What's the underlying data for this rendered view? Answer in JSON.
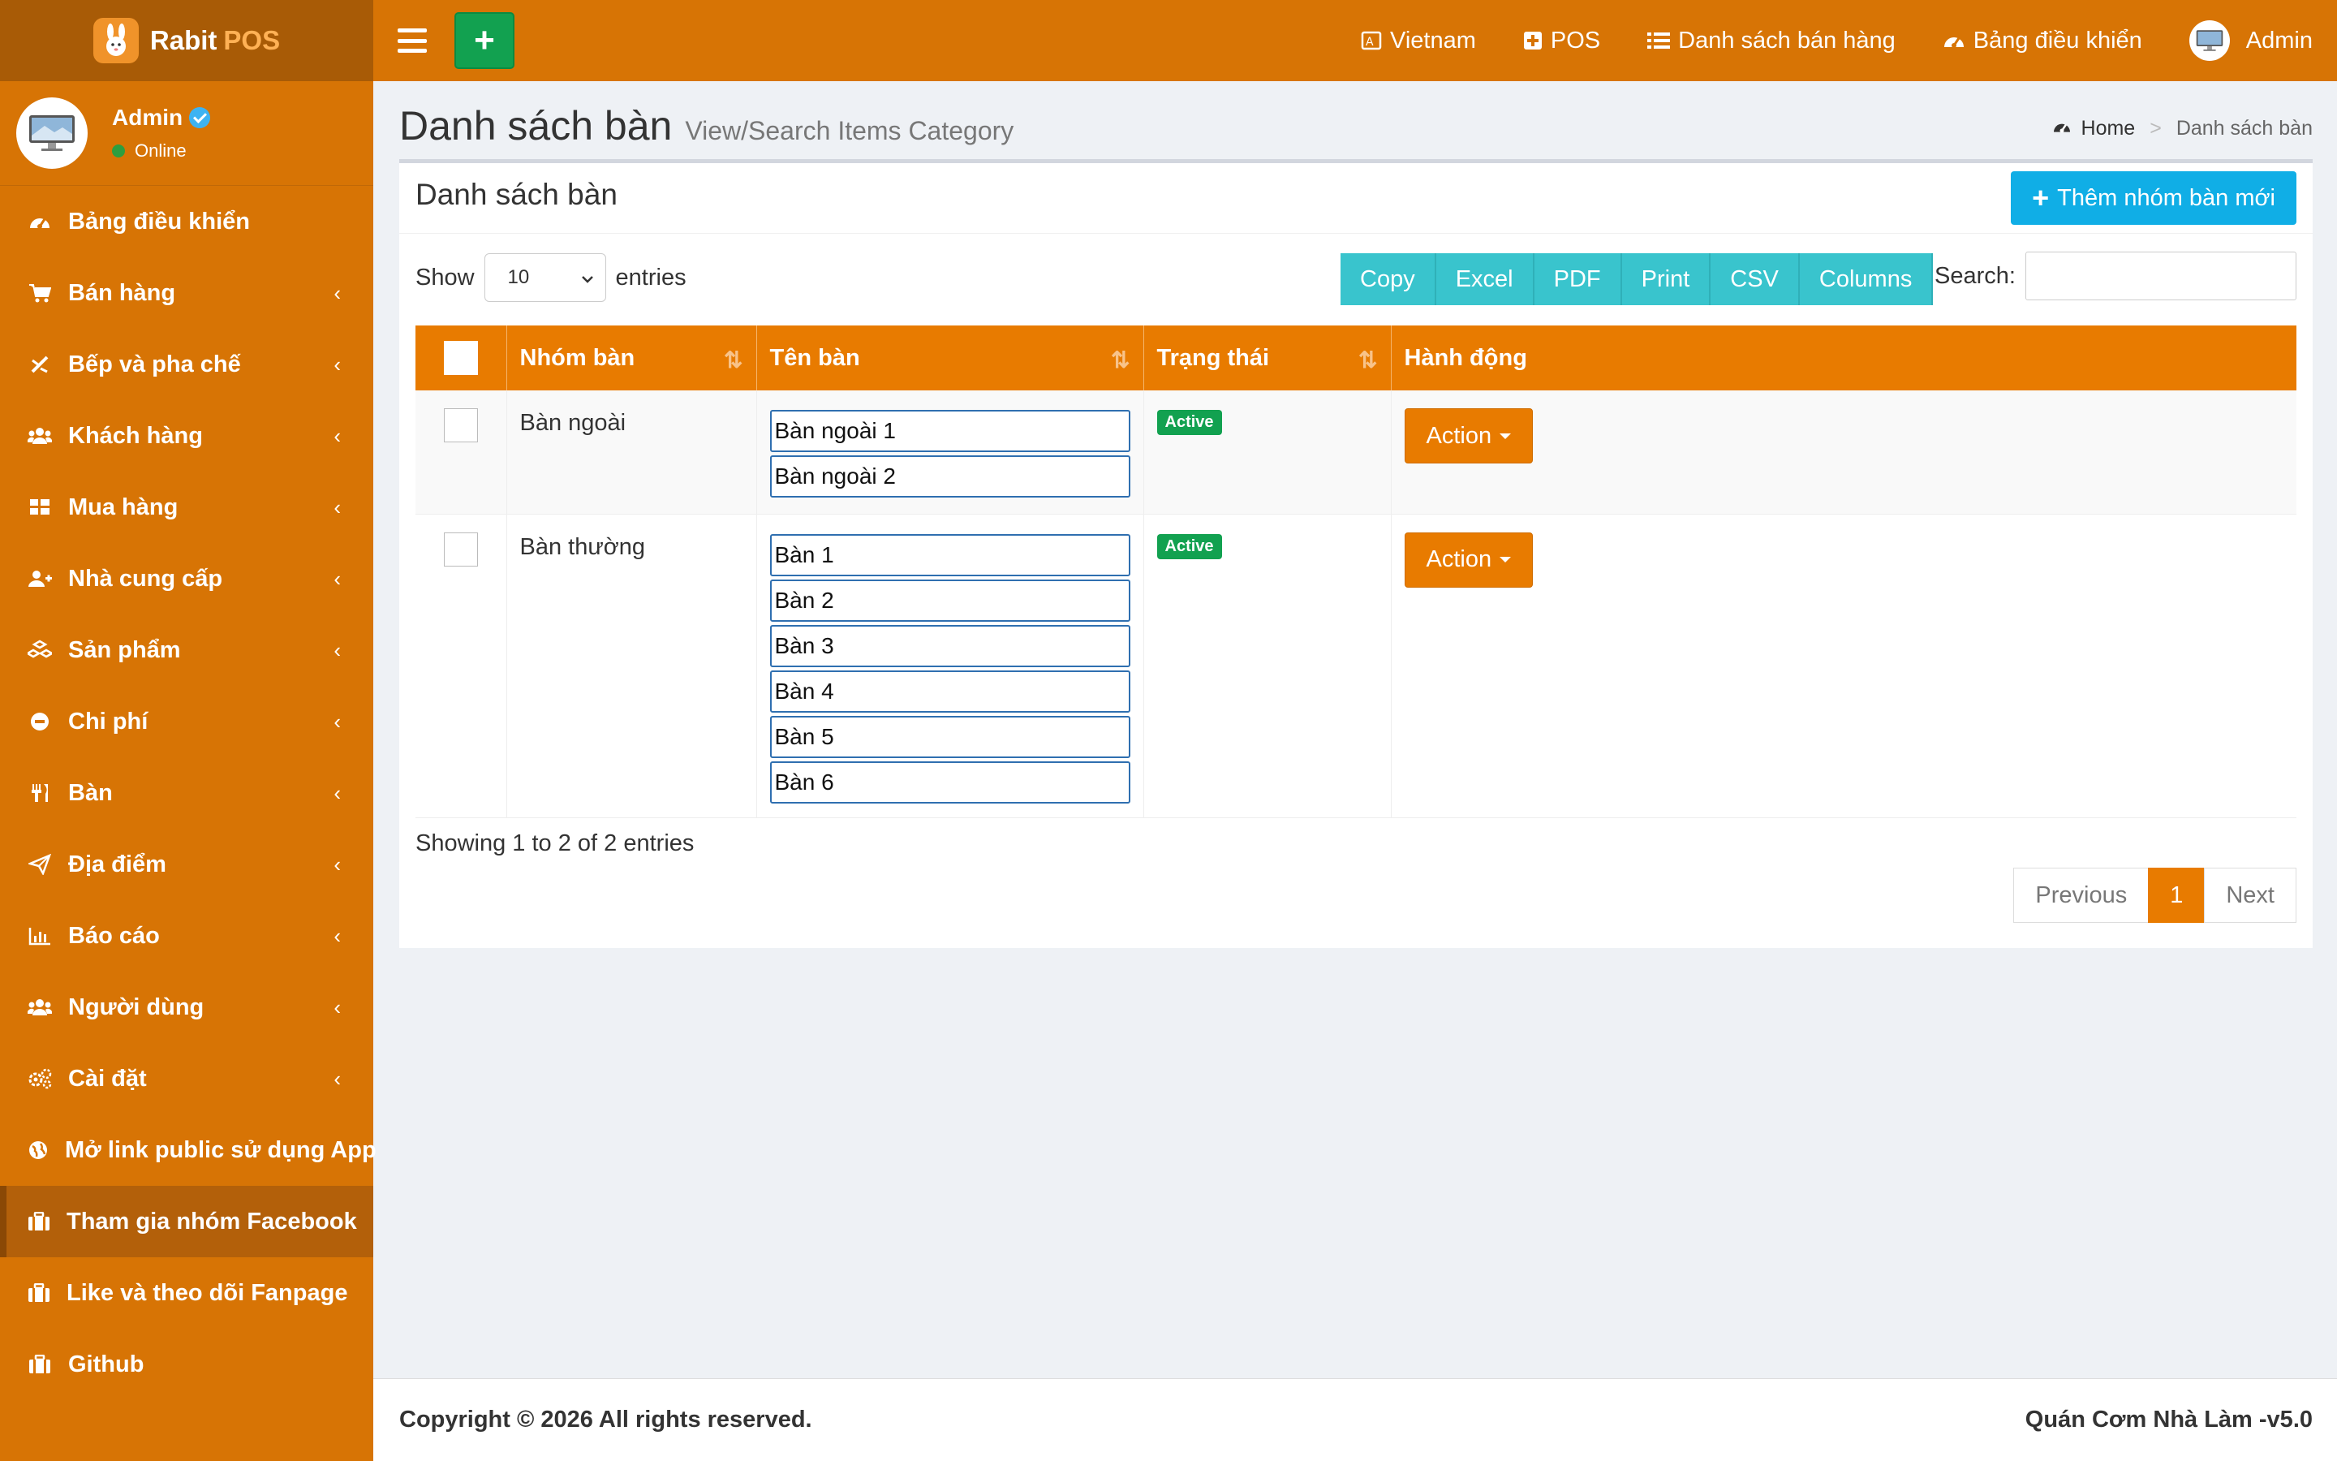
{
  "brand": {
    "name": "Rabit",
    "suffix": "POS"
  },
  "user": {
    "name": "Admin",
    "status": "Online"
  },
  "sidebar": {
    "items": [
      {
        "label": "Bảng điều khiển",
        "icon": "dashboard-icon",
        "has_children": false
      },
      {
        "label": "Bán hàng",
        "icon": "cart-icon",
        "has_children": true
      },
      {
        "label": "Bếp và pha chế",
        "icon": "kitchen-icon",
        "has_children": true
      },
      {
        "label": "Khách hàng",
        "icon": "users-icon",
        "has_children": true
      },
      {
        "label": "Mua hàng",
        "icon": "grid-icon",
        "has_children": true
      },
      {
        "label": "Nhà cung cấp",
        "icon": "user-plus-icon",
        "has_children": true
      },
      {
        "label": "Sản phẩm",
        "icon": "cubes-icon",
        "has_children": true
      },
      {
        "label": "Chi phí",
        "icon": "minus-circle-icon",
        "has_children": true
      },
      {
        "label": "Bàn",
        "icon": "cutlery-icon",
        "has_children": true
      },
      {
        "label": "Địa điểm",
        "icon": "paper-plane-icon",
        "has_children": true
      },
      {
        "label": "Báo cáo",
        "icon": "bar-chart-icon",
        "has_children": true
      },
      {
        "label": "Người dùng",
        "icon": "users-icon",
        "has_children": true
      },
      {
        "label": "Cài đặt",
        "icon": "gears-icon",
        "has_children": true
      },
      {
        "label": "Mở link public sử dụng App",
        "icon": "globe-icon",
        "has_children": false
      },
      {
        "label": "Tham gia nhóm Facebook",
        "icon": "briefcase-icon",
        "has_children": false,
        "active": true
      },
      {
        "label": "Like và theo dõi Fanpage",
        "icon": "briefcase-icon",
        "has_children": false
      },
      {
        "label": "Github",
        "icon": "briefcase-icon",
        "has_children": false
      }
    ]
  },
  "topbar": {
    "plus_label": "+",
    "language": "Vietnam",
    "pos": "POS",
    "sales_list": "Danh sách bán hàng",
    "dashboard": "Bảng điều khiển",
    "admin": "Admin"
  },
  "page": {
    "title": "Danh sách bàn",
    "subtitle": "View/Search Items Category",
    "breadcrumb_home": "Home",
    "breadcrumb_sep": ">",
    "breadcrumb_current": "Danh sách bàn"
  },
  "box": {
    "title": "Danh sách bàn",
    "add_button": "Thêm nhóm bàn mới"
  },
  "controls": {
    "show_label": "Show",
    "entries_value": "10",
    "entries_label": "entries",
    "buttons": [
      "Copy",
      "Excel",
      "PDF",
      "Print",
      "CSV",
      "Columns"
    ],
    "search_label": "Search:"
  },
  "table": {
    "headers": {
      "group": "Nhóm bàn",
      "name": "Tên bàn",
      "status": "Trạng thái",
      "action": "Hành động"
    },
    "rows": [
      {
        "group": "Bàn ngoài",
        "tables": [
          "Bàn ngoài 1",
          "Bàn ngoài 2"
        ],
        "status": "Active",
        "action": "Action"
      },
      {
        "group": "Bàn thường",
        "tables": [
          "Bàn 1",
          "Bàn 2",
          "Bàn 3",
          "Bàn 4",
          "Bàn 5",
          "Bàn 6"
        ],
        "status": "Active",
        "action": "Action"
      }
    ]
  },
  "pagination": {
    "info": "Showing 1 to 2 of 2 entries",
    "previous": "Previous",
    "current": "1",
    "next": "Next"
  },
  "footer": {
    "copyright": "Copyright © 2026 All rights reserved.",
    "version": "Quán Cơm Nhà Làm -v5.0"
  },
  "colors": {
    "sidebar": "#d77405",
    "accent": "#e87b00",
    "success": "#12a150",
    "info": "#10aee6",
    "export_buttons": "#39c4cd"
  }
}
